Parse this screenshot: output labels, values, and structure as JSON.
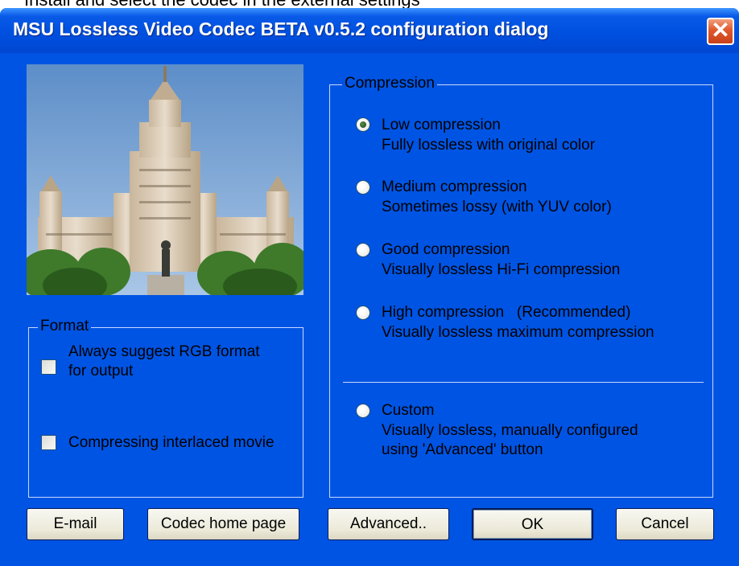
{
  "background_caption": "Install and select the codec in the external settings",
  "window": {
    "title": "MSU Lossless Video Codec BETA v0.5.2 configuration dialog",
    "close_glyph": "✕"
  },
  "format_group": {
    "legend": "Format",
    "rgb_label_line1": "Always suggest RGB format",
    "rgb_label_line2": "for output",
    "rgb_checked": false,
    "interlaced_label": "Compressing interlaced movie",
    "interlaced_checked": false
  },
  "compression_group": {
    "legend": "Compression",
    "selected": "low",
    "options": [
      {
        "id": "low",
        "title": "Low compression",
        "desc": "Fully lossless with original color"
      },
      {
        "id": "medium",
        "title": "Medium compression",
        "desc": "Sometimes lossy (with YUV color)"
      },
      {
        "id": "good",
        "title": "Good compression",
        "desc": "Visually lossless Hi-Fi compression"
      },
      {
        "id": "high",
        "title": "High compression   (Recommended)",
        "desc": "Visually lossless maximum compression"
      },
      {
        "id": "custom",
        "title": "Custom",
        "desc": "Visually lossless, manually configured",
        "desc2": "using 'Advanced' button"
      }
    ]
  },
  "buttons": {
    "email": "E-mail",
    "home": "Codec home page",
    "advanced": "Advanced..",
    "ok": "OK",
    "cancel": "Cancel"
  },
  "colors": {
    "dialog_bg": "#0054e3",
    "titlebar": "#0050e0",
    "close_button": "#e0582c",
    "group_border": "#c8daff"
  }
}
